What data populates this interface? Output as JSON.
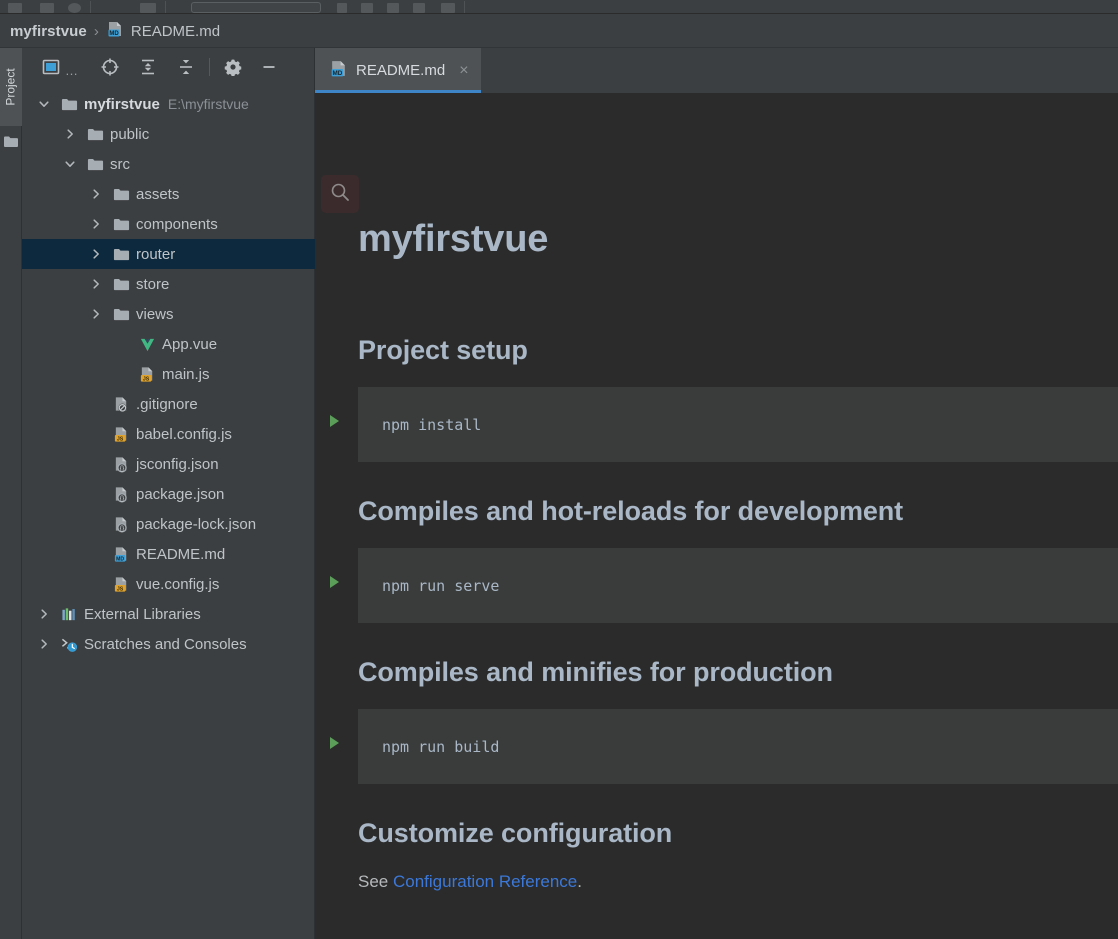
{
  "window": {
    "background_color": "#2b2b2b",
    "panel_color": "#3c3f41",
    "accent_color": "#3d85c6",
    "selection_color": "#0d293e"
  },
  "breadcrumb": {
    "root": "myfirstvue",
    "separator": "›",
    "file": "README.md",
    "file_icon": "markdown-file-icon"
  },
  "tool_stripe": {
    "label": "Project",
    "icon": "folder-icon"
  },
  "project_panel": {
    "toolbar": [
      {
        "name": "project-view-selector-icon",
        "label": ""
      },
      {
        "name": "ellipsis-icon",
        "label": "…"
      },
      {
        "name": "locate-file-icon",
        "label": ""
      },
      {
        "name": "expand-all-icon",
        "label": ""
      },
      {
        "name": "collapse-all-icon",
        "label": ""
      },
      {
        "name": "settings-gear-icon",
        "label": ""
      },
      {
        "name": "hide-panel-icon",
        "label": ""
      }
    ],
    "tree": [
      {
        "label": "myfirstvue",
        "hint": "E:\\myfirstvue",
        "icon": "folder-icon",
        "twisty": "down",
        "indent": 0,
        "root": true,
        "selected": false
      },
      {
        "label": "public",
        "hint": "",
        "icon": "folder-icon",
        "twisty": "right",
        "indent": 1,
        "root": false,
        "selected": false
      },
      {
        "label": "src",
        "hint": "",
        "icon": "folder-icon",
        "twisty": "down",
        "indent": 1,
        "root": false,
        "selected": false
      },
      {
        "label": "assets",
        "hint": "",
        "icon": "folder-icon",
        "twisty": "right",
        "indent": 2,
        "root": false,
        "selected": false
      },
      {
        "label": "components",
        "hint": "",
        "icon": "folder-icon",
        "twisty": "right",
        "indent": 2,
        "root": false,
        "selected": false
      },
      {
        "label": "router",
        "hint": "",
        "icon": "folder-icon",
        "twisty": "right",
        "indent": 2,
        "root": false,
        "selected": true
      },
      {
        "label": "store",
        "hint": "",
        "icon": "folder-icon",
        "twisty": "right",
        "indent": 2,
        "root": false,
        "selected": false
      },
      {
        "label": "views",
        "hint": "",
        "icon": "folder-icon",
        "twisty": "right",
        "indent": 2,
        "root": false,
        "selected": false
      },
      {
        "label": "App.vue",
        "hint": "",
        "icon": "vue-file-icon",
        "twisty": "none",
        "indent": 3,
        "root": false,
        "selected": false
      },
      {
        "label": "main.js",
        "hint": "",
        "icon": "js-file-icon",
        "twisty": "none",
        "indent": 3,
        "root": false,
        "selected": false
      },
      {
        "label": ".gitignore",
        "hint": "",
        "icon": "gitignore-file-icon",
        "twisty": "none",
        "indent": 2,
        "root": false,
        "selected": false
      },
      {
        "label": "babel.config.js",
        "hint": "",
        "icon": "js-file-icon",
        "twisty": "none",
        "indent": 2,
        "root": false,
        "selected": false
      },
      {
        "label": "jsconfig.json",
        "hint": "",
        "icon": "json-file-icon",
        "twisty": "none",
        "indent": 2,
        "root": false,
        "selected": false
      },
      {
        "label": "package.json",
        "hint": "",
        "icon": "json-file-icon",
        "twisty": "none",
        "indent": 2,
        "root": false,
        "selected": false
      },
      {
        "label": "package-lock.json",
        "hint": "",
        "icon": "json-file-icon",
        "twisty": "none",
        "indent": 2,
        "root": false,
        "selected": false
      },
      {
        "label": "README.md",
        "hint": "",
        "icon": "markdown-file-icon",
        "twisty": "none",
        "indent": 2,
        "root": false,
        "selected": false
      },
      {
        "label": "vue.config.js",
        "hint": "",
        "icon": "js-file-icon",
        "twisty": "none",
        "indent": 2,
        "root": false,
        "selected": false
      },
      {
        "label": "External Libraries",
        "hint": "",
        "icon": "external-libraries-icon",
        "twisty": "right",
        "indent": 0,
        "root": false,
        "selected": false
      },
      {
        "label": "Scratches and Consoles",
        "hint": "",
        "icon": "scratches-icon",
        "twisty": "right",
        "indent": 0,
        "root": false,
        "selected": false
      }
    ]
  },
  "editor": {
    "tabs": [
      {
        "label": "README.md",
        "icon": "markdown-file-icon",
        "close": "×",
        "active": true
      }
    ]
  },
  "preview": {
    "search_icon": "search-icon",
    "title": "myfirstvue",
    "sections": [
      {
        "heading": "Project setup",
        "code": "npm install",
        "run_icon": "run-arrow-icon"
      },
      {
        "heading": "Compiles and hot-reloads for development",
        "code": "npm run serve",
        "run_icon": "run-arrow-icon"
      },
      {
        "heading": "Compiles and minifies for production",
        "code": "npm run build",
        "run_icon": "run-arrow-icon"
      }
    ],
    "customize": {
      "heading": "Customize configuration",
      "text_before": "See ",
      "link": "Configuration Reference",
      "text_after": "."
    }
  }
}
